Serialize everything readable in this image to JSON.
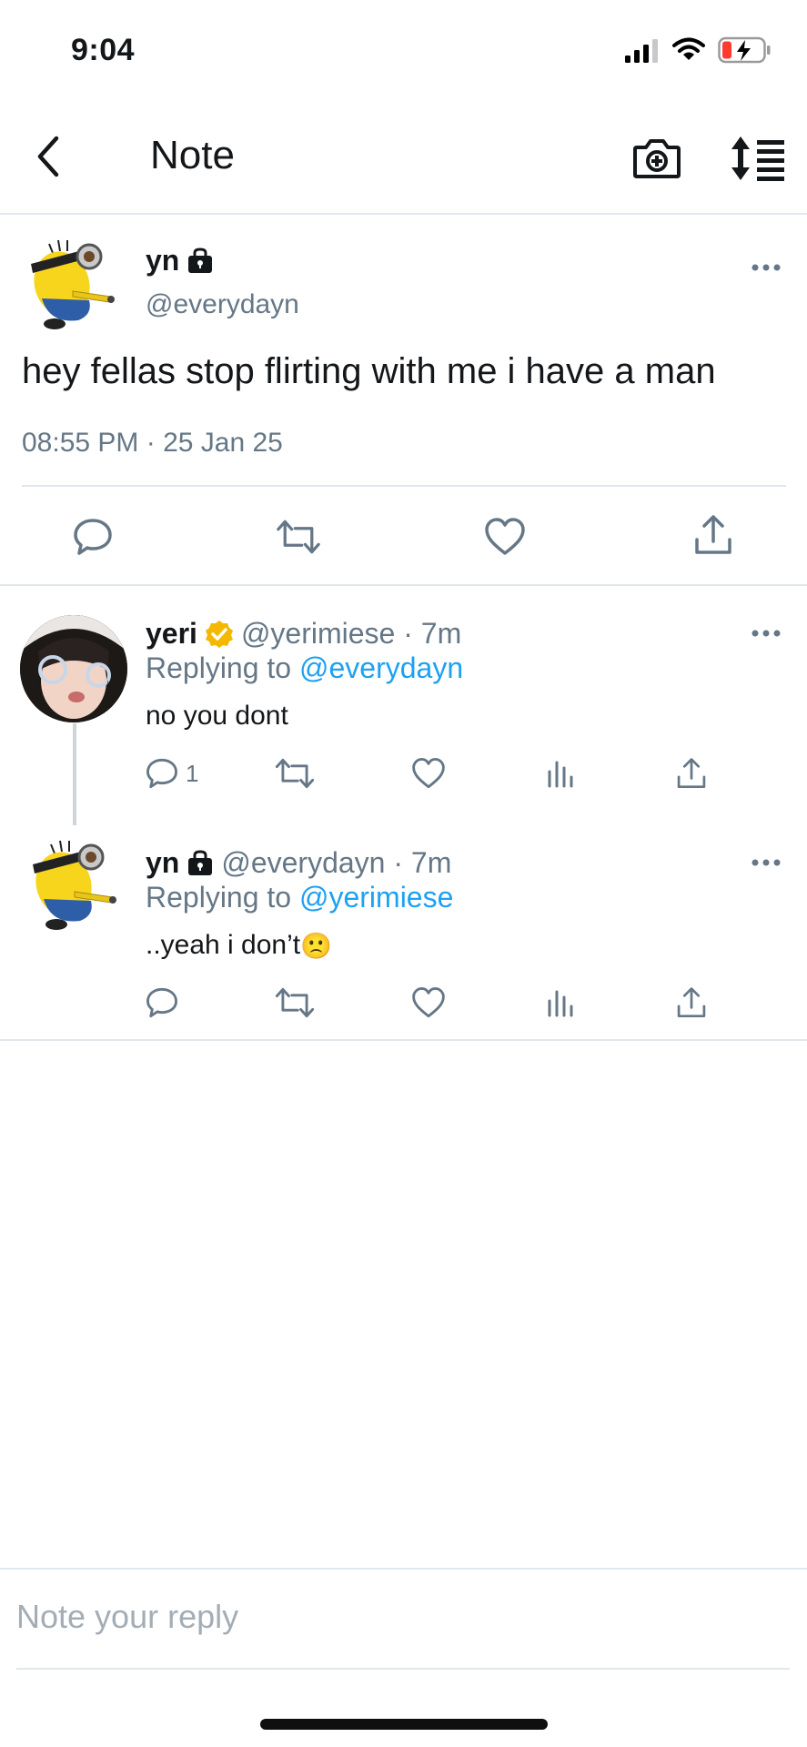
{
  "status_bar": {
    "time": "9:04"
  },
  "nav": {
    "title": "Note"
  },
  "main_tweet": {
    "name": "yn",
    "handle": "@everydayn",
    "text": "hey fellas stop flirting with me i have a man",
    "datetime": "08:55 PM · 25 Jan 25"
  },
  "replies": [
    {
      "name": "yeri",
      "meta": "@yerimiese · 7m",
      "replying_prefix": "Replying to ",
      "replying_to": "@everydayn",
      "text": "no you dont",
      "reply_count": "1"
    },
    {
      "name": "yn",
      "meta": "@everydayn · 7m",
      "replying_prefix": "Replying to ",
      "replying_to": "@yerimiese",
      "text": "..yeah i don’t",
      "emoji": "🙁"
    }
  ],
  "composer": {
    "placeholder": "Note your reply"
  },
  "colors": {
    "accent": "#1da1f2",
    "muted": "#657786",
    "verified": "#f5b800",
    "battery_low": "#ff3b30"
  }
}
